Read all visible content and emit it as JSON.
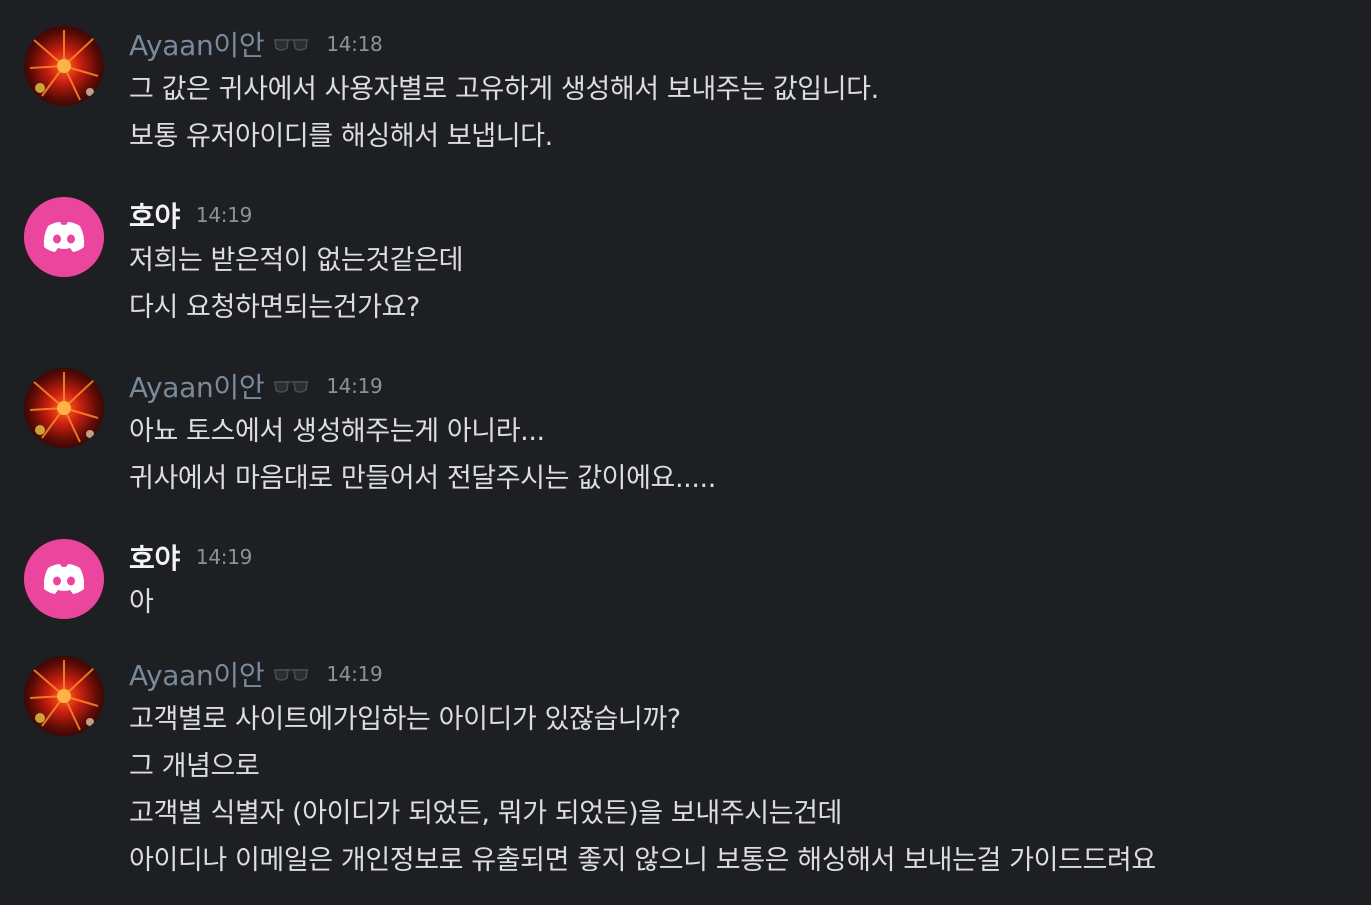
{
  "colors": {
    "background": "#1e1f22",
    "text": "#dcddde",
    "muted_username": "#7a8a9c",
    "discord_pink": "#eb459e"
  },
  "messages": [
    {
      "author": "Ayaan이안",
      "badge_icon": "sunglasses-icon",
      "time": "14:18",
      "lines": [
        "그 값은 귀사에서 사용자별로 고유하게 생성해서 보내주는 값입니다.",
        "보통 유저아이디를 해싱해서 보냅니다."
      ]
    },
    {
      "author": "호야",
      "time": "14:19",
      "lines": [
        "저희는 받은적이 없는것같은데",
        "다시 요청하면되는건가요?"
      ]
    },
    {
      "author": "Ayaan이안",
      "badge_icon": "sunglasses-icon",
      "time": "14:19",
      "lines": [
        "아뇨 토스에서 생성해주는게 아니라...",
        "귀사에서 마음대로 만들어서 전달주시는 값이에요....."
      ]
    },
    {
      "author": "호야",
      "time": "14:19",
      "lines": [
        "아"
      ]
    },
    {
      "author": "Ayaan이안",
      "badge_icon": "sunglasses-icon",
      "time": "14:19",
      "lines": [
        "고객별로 사이트에가입하는 아이디가 있잖습니까?",
        "그 개념으로",
        "고객별 식별자 (아이디가 되었든, 뭐가 되었든)을 보내주시는건데",
        "아이디나 이메일은 개인정보로 유출되면 좋지 않으니 보통은 해싱해서 보내는걸 가이드드려요"
      ]
    }
  ]
}
